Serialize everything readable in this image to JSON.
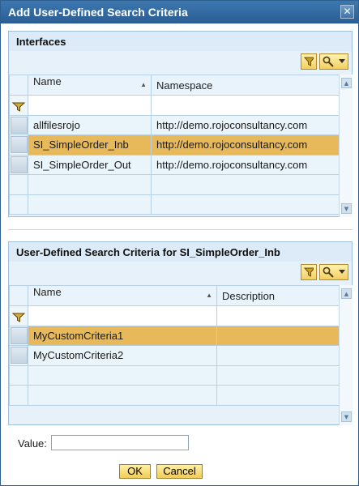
{
  "window": {
    "title": "Add User-Defined Search Criteria",
    "close_glyph": "✕"
  },
  "interfaces_panel": {
    "title": "Interfaces",
    "columns": [
      "Name",
      "Namespace"
    ],
    "rows": [
      {
        "name": "allfilesrojo",
        "namespace": "http://demo.rojoconsultancy.com",
        "selected": false
      },
      {
        "name": "SI_SimpleOrder_Inb",
        "namespace": "http://demo.rojoconsultancy.com",
        "selected": true
      },
      {
        "name": "SI_SimpleOrder_Out",
        "namespace": "http://demo.rojoconsultancy.com",
        "selected": false
      }
    ]
  },
  "criteria_panel": {
    "title": "User-Defined Search Criteria for  SI_SimpleOrder_Inb",
    "columns": [
      "Name",
      "Description"
    ],
    "rows": [
      {
        "name": "MyCustomCriteria1",
        "description": "",
        "selected": true
      },
      {
        "name": "MyCustomCriteria2",
        "description": "",
        "selected": false
      }
    ]
  },
  "form": {
    "value_label": "Value:",
    "value": "",
    "ok_label": "OK",
    "cancel_label": "Cancel"
  },
  "icons": {
    "filter": "filter-icon",
    "settings": "wrench-icon",
    "sort": "sort-ascending-icon"
  },
  "colors": {
    "titlebar": "#2f69a0",
    "selected_row": "#e8b95a",
    "button": "#f3cf60"
  }
}
